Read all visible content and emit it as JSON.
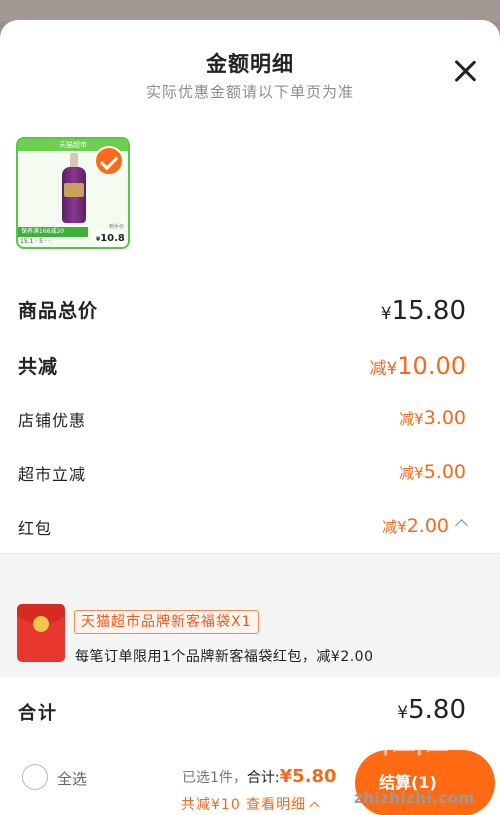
{
  "header": {
    "title": "金额明细",
    "subtitle": "实际优惠金额请以下单页为准"
  },
  "product": {
    "band_text": "天猫超市",
    "deal_text": "保养满168减20",
    "spec_text": "15.1  ·  5  ·  ·",
    "price_caption": "到手价",
    "price": "10.8",
    "selected": true
  },
  "breakdown": {
    "total": {
      "label": "商品总价",
      "currency": "¥",
      "amount": "15.80"
    },
    "discount": {
      "label": "共减",
      "prefix": "减¥",
      "amount": "10.00"
    },
    "items": [
      {
        "label": "店铺优惠",
        "prefix": "减¥",
        "amount": "3.00"
      },
      {
        "label": "超市立减",
        "prefix": "减¥",
        "amount": "5.00"
      },
      {
        "label": "红包",
        "prefix": "减¥",
        "amount": "2.00",
        "expanded": true
      }
    ]
  },
  "red_packet": {
    "tag": "天猫超市品牌新客福袋X1",
    "description": "每笔订单限用1个品牌新客福袋红包，减¥2.00"
  },
  "summary": {
    "label": "合计",
    "currency": "¥",
    "amount": "5.80"
  },
  "checkout_bar": {
    "select_all": "全选",
    "selected_count": "已选1件，",
    "total_label": "合计:",
    "total_amount": "¥5.80",
    "savings": "共减¥10 查看明细",
    "settle_button": "结算(1)"
  },
  "watermark": {
    "text": "值|值|值",
    "site": "zhizhizhi.com"
  },
  "colors": {
    "accent": "#ff6a12",
    "discount": "#f26a1b",
    "check": "#ff6a1a",
    "envelope": "#e8372f"
  }
}
